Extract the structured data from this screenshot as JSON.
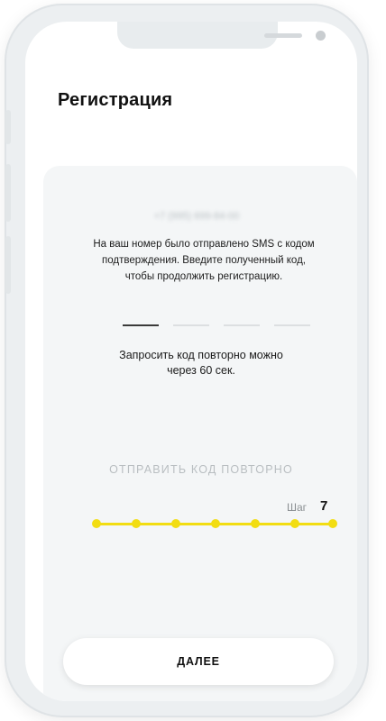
{
  "header": {
    "title": "Регистрация"
  },
  "verification": {
    "phone_number": "+7 (995) 699-84-00",
    "info_text": "На ваш номер было отправлено SMS с кодом подтверждения. Введите полученный код, чтобы продолжить регистрацию.",
    "code_slots": 4,
    "filled_slots": 1,
    "resend_timer_text": "Запросить код повторно можно через 60 сек.",
    "resend_button_label": "ОТПРАВИТЬ КОД ПОВТОРНО"
  },
  "progress": {
    "step_label": "Шаг",
    "step_number": "7",
    "total_steps": 7,
    "current_step": 7,
    "accent_color": "#F2DD12"
  },
  "footer": {
    "next_button_label": "ДАЛЕЕ"
  }
}
